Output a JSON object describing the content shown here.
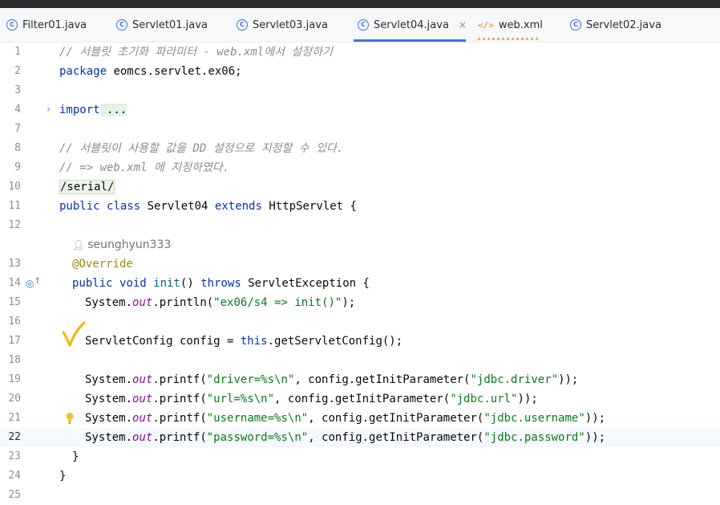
{
  "tabs": [
    {
      "label": "Filter01.java",
      "icon": "class-icon"
    },
    {
      "label": "Servlet01.java",
      "icon": "class-icon"
    },
    {
      "label": "Servlet03.java",
      "icon": "class-icon"
    },
    {
      "label": "Servlet04.java",
      "icon": "class-icon",
      "active": true,
      "close": "×"
    },
    {
      "label": "web.xml",
      "icon": "xml-icon"
    },
    {
      "label": "Servlet02.java",
      "icon": "class-icon"
    }
  ],
  "editor": {
    "current_line": 22,
    "line_numbers": [
      "1",
      "2",
      "3",
      "4",
      "7",
      "8",
      "9",
      "10",
      "11",
      "12",
      "13",
      "14",
      "15",
      "16",
      "17",
      "18",
      "19",
      "20",
      "21",
      "22",
      "23",
      "24",
      "25"
    ],
    "author_hint": "seunghyun333",
    "lines": {
      "l1": "// 서블릿 초기화 파라미터 - web.xml에서 설정하기",
      "l2_kw": "package",
      "l2_rest": " eomcs.servlet.ex06;",
      "l4_kw": "import",
      "l4_rest": " ...",
      "l8": "// 서블릿이 사용할 값을 DD 설정으로 지정할 수 있다.",
      "l9": "// => web.xml 에 지정하였다.",
      "l10": "/serial/",
      "l11_kw1": "public",
      "l11_kw2": "class",
      "l11_name": "Servlet04",
      "l11_kw3": "extends",
      "l11_rest": "HttpServlet {",
      "l13": "@Override",
      "l14_kw1": "public",
      "l14_kw2": "void",
      "l14_fn": "init",
      "l14_mid": "()",
      "l14_kw3": "throws",
      "l14_rest": "ServletException {",
      "l15_a": "System.",
      "l15_out": "out",
      "l15_b": ".println(",
      "l15_str": "\"ex06/s4 => init()\"",
      "l15_c": ");",
      "l17_a": "ServletConfig config = ",
      "l17_kw": "this",
      "l17_b": ".getServletConfig();",
      "l19_a": "System.",
      "l19_out": "out",
      "l19_b": ".printf(",
      "l19_s1": "\"driver=%s\\n\"",
      "l19_c": ", config.getInitParameter(",
      "l19_s2": "\"jdbc.driver\"",
      "l19_d": "));",
      "l20_a": "System.",
      "l20_out": "out",
      "l20_b": ".printf(",
      "l20_s1": "\"url=%s\\n\"",
      "l20_c": ", config.getInitParameter(",
      "l20_s2": "\"jdbc.url\"",
      "l20_d": "));",
      "l21_a": "System.",
      "l21_out": "out",
      "l21_b": ".printf(",
      "l21_s1": "\"username=%s\\n\"",
      "l21_c": ", config.getInitParameter(",
      "l21_s2": "\"jdbc.username\"",
      "l21_d": "));",
      "l22_a": "System.",
      "l22_out": "out",
      "l22_b": ".printf(",
      "l22_s1": "\"password=%s\\n\"",
      "l22_c": ", config.getInitParameter(",
      "l22_s2": "\"jdbc.password\"",
      "l22_d": "));",
      "l23": "}",
      "l24": "}"
    }
  },
  "colors": {
    "accent": "#3574f0",
    "keyword": "#0033b3",
    "string": "#067d17",
    "comment": "#8c8c8c",
    "annotation": "#9e880d",
    "field": "#871094",
    "checkmark": "#f5b400"
  }
}
